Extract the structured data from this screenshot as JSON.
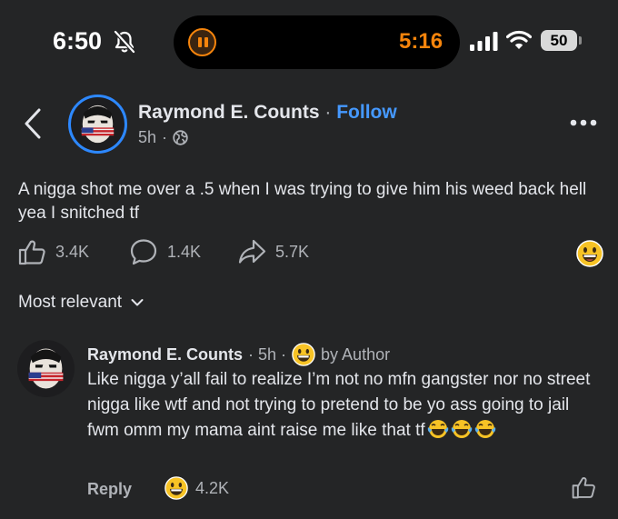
{
  "status_bar": {
    "time": "6:50",
    "activity_time": "5:16",
    "battery": "50",
    "icons": [
      "bell-slash-icon",
      "pause-icon",
      "signal-icon",
      "wifi-icon",
      "battery-icon"
    ],
    "activity_color": "#f5840c"
  },
  "header": {
    "author": "Raymond E. Counts",
    "separator": "·",
    "follow": "Follow",
    "age": "5h",
    "age_separator": "·",
    "icons": [
      "back-icon",
      "globe-icon",
      "more-icon"
    ]
  },
  "post": {
    "text": "A nigga shot me over a .5 when I was trying to give him his weed back hell yea I snitched tf",
    "likes": "3.4K",
    "comments": "1.4K",
    "shares": "5.7K",
    "icons": [
      "like-icon",
      "comment-icon",
      "share-icon",
      "grin-emoji-icon"
    ]
  },
  "sort": {
    "label": "Most relevant"
  },
  "comment": {
    "author": "Raymond E. Counts",
    "time": "· 5h ·",
    "badge": "by Author",
    "text": "Like nigga y’all fail to realize I’m not no mfn gangster nor no street nigga like wtf and not trying to pretend to be yo ass going to jail fwm omm my mama aint raise me like that tf",
    "laugh_emojis": 3,
    "reply": "Reply",
    "reactions": "4.2K"
  },
  "colors": {
    "background": "#242526",
    "text": "#e4e6eb",
    "muted": "#b0b3b8",
    "link": "#4599ff",
    "avatar_ring": "#2d88ff",
    "emoji": "#f7c325"
  }
}
